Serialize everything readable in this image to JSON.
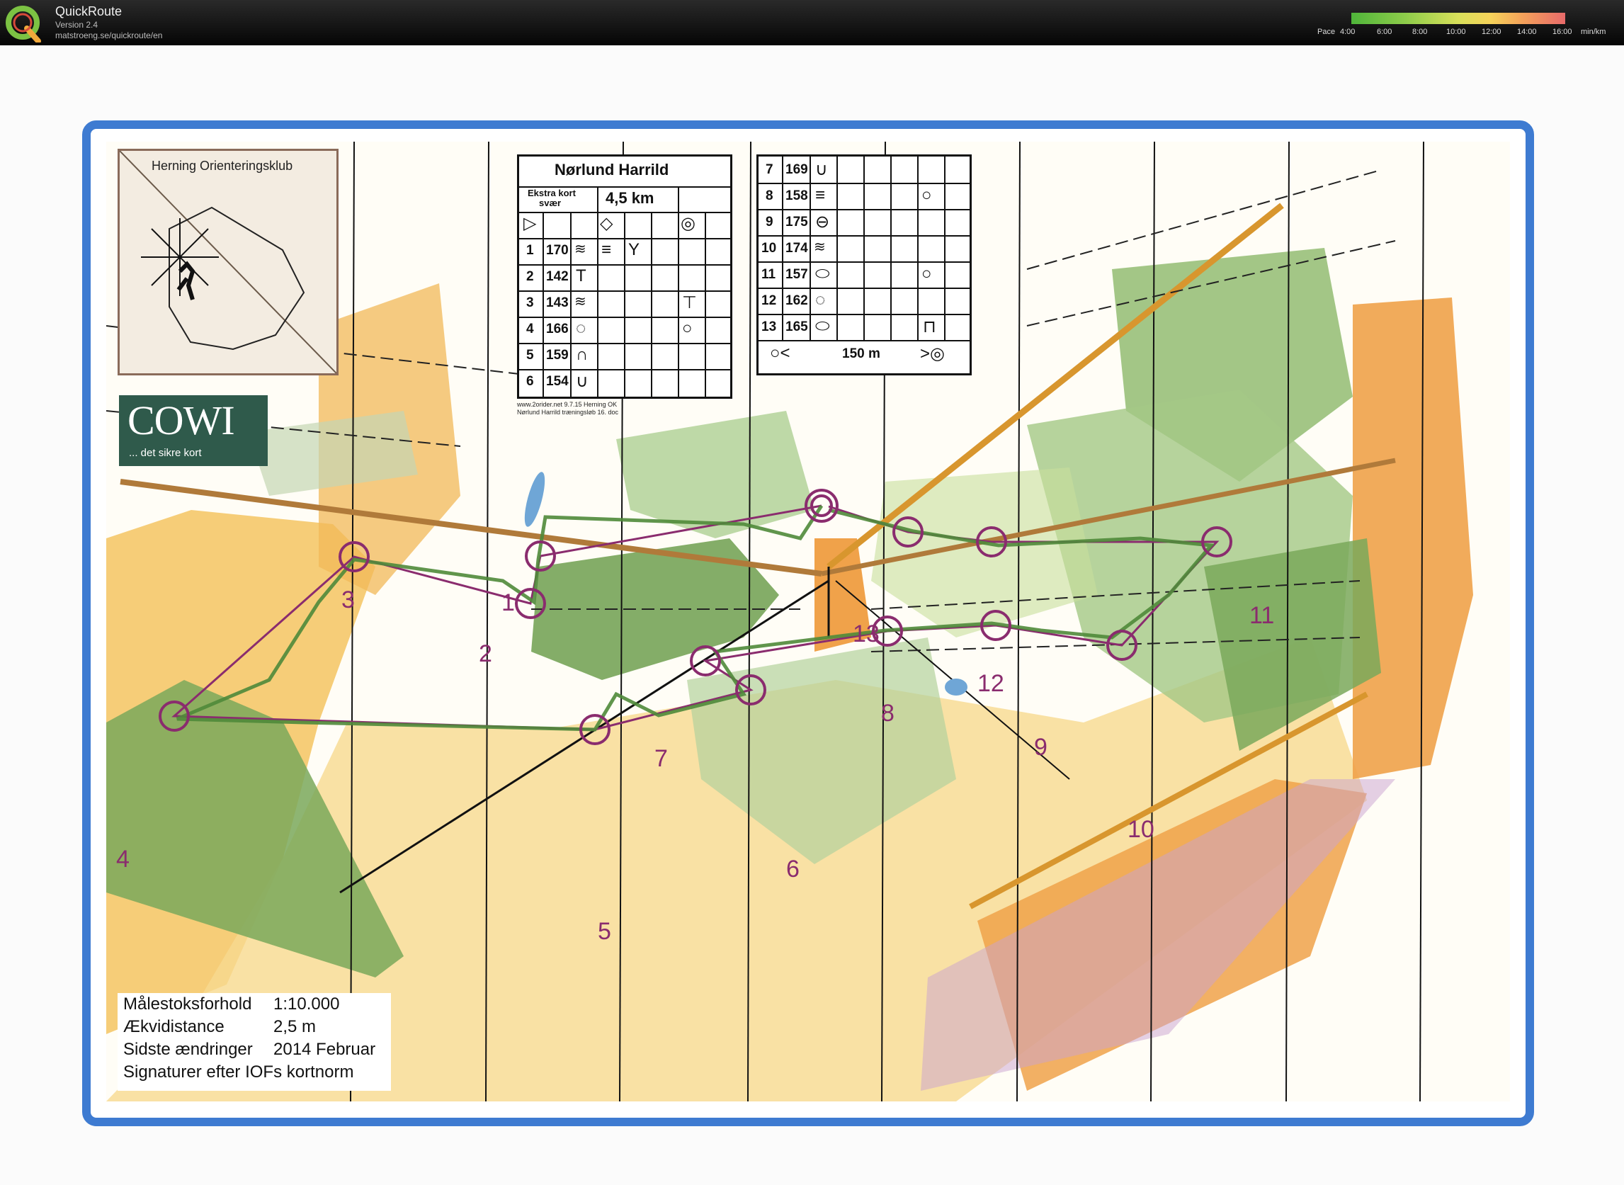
{
  "app": {
    "name": "QuickRoute",
    "version": "Version 2.4",
    "url": "matstroeng.se/quickroute/en"
  },
  "pace_legend": {
    "label": "Pace",
    "ticks": [
      "4:00",
      "6:00",
      "8:00",
      "10:00",
      "12:00",
      "14:00",
      "16:00"
    ],
    "unit": "min/km",
    "colors": [
      "#4fb53a",
      "#8dcc4a",
      "#d8e05a",
      "#f6d35a",
      "#f4a25a",
      "#e86a6a"
    ]
  },
  "map": {
    "club": "Herning Orienteringsklub",
    "sponsor": {
      "name": "COWI",
      "tagline": "... det sikre kort"
    },
    "credit_lines": [
      "www.2orider.net 9.7.15 Herning OK",
      "Nørlund Harrild træningsløb 16. doc"
    ],
    "course": {
      "title": "Nørlund Harrild",
      "class": "Ekstra kort",
      "difficulty": "svær",
      "length": "4,5 km",
      "controls": [
        {
          "n": "1",
          "code": "170"
        },
        {
          "n": "2",
          "code": "142"
        },
        {
          "n": "3",
          "code": "143"
        },
        {
          "n": "4",
          "code": "166"
        },
        {
          "n": "5",
          "code": "159"
        },
        {
          "n": "6",
          "code": "154"
        },
        {
          "n": "7",
          "code": "169"
        },
        {
          "n": "8",
          "code": "158"
        },
        {
          "n": "9",
          "code": "175"
        },
        {
          "n": "10",
          "code": "174"
        },
        {
          "n": "11",
          "code": "157"
        },
        {
          "n": "12",
          "code": "162"
        },
        {
          "n": "13",
          "code": "165"
        }
      ],
      "finish_distance": "150 m"
    },
    "info": [
      {
        "label": "Målestoksforhold",
        "value": "1:10.000"
      },
      {
        "label": "Ækvidistance",
        "value": "2,5 m"
      },
      {
        "label": "Sidste ændringer",
        "value": "2014 Februar"
      },
      {
        "label": "Signaturer efter IOFs kortnorm",
        "value": ""
      }
    ],
    "control_labels": [
      "1",
      "2",
      "3",
      "4",
      "5",
      "6",
      "7",
      "8",
      "9",
      "10",
      "11",
      "12",
      "13"
    ],
    "colors": {
      "frame": "#3e7bd1",
      "course": "#8a2c6e",
      "forest_green": "#7aa85a",
      "open_yellow": "#f4c462",
      "route": "#4f8a3a"
    }
  }
}
